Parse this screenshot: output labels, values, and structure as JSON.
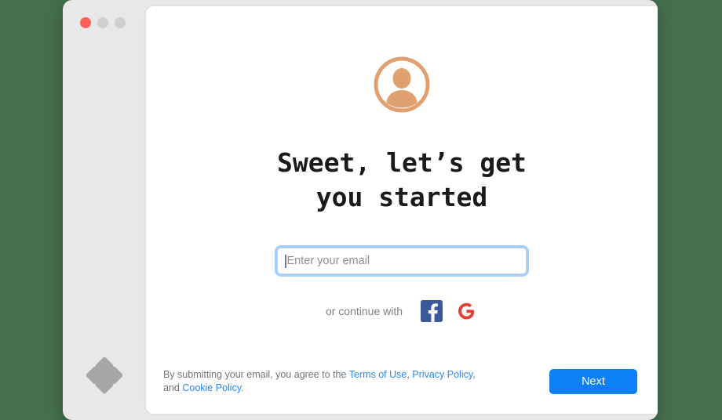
{
  "window": {
    "traffic_lights": [
      {
        "name": "close",
        "color": "#fc6058"
      },
      {
        "name": "minimize",
        "color": "#cfcfcf"
      },
      {
        "name": "maximize",
        "color": "#cfcfcf"
      }
    ],
    "background_color": "#46704d",
    "chrome_color": "#e8e8e8"
  },
  "sidebar": {
    "logo_name": "dropbox-logo",
    "logo_color": "#a6a6a6"
  },
  "main": {
    "avatar": {
      "icon": "user-avatar-icon",
      "color": "#e0a070"
    },
    "headline": "Sweet, let’s get\nyou started",
    "email": {
      "value": "",
      "placeholder": "Enter your email",
      "focused": true,
      "focus_ring_color": "#50a5ff"
    },
    "social": {
      "label": "or continue with",
      "providers": [
        {
          "name": "facebook",
          "icon": "facebook-icon",
          "color": "#3b5998",
          "glyph": "f"
        },
        {
          "name": "google",
          "icon": "google-icon",
          "color": "#e2412f",
          "glyph": "G"
        }
      ]
    }
  },
  "footer": {
    "legal_prefix": "By submitting your email, you agree to the ",
    "links": [
      {
        "label": "Terms of Use",
        "sep": ", "
      },
      {
        "label": "Privacy Policy",
        "sep": ", and "
      },
      {
        "label": "Cookie Policy",
        "sep": "."
      }
    ],
    "next_label": "Next",
    "next_color": "#0d7ff7"
  }
}
